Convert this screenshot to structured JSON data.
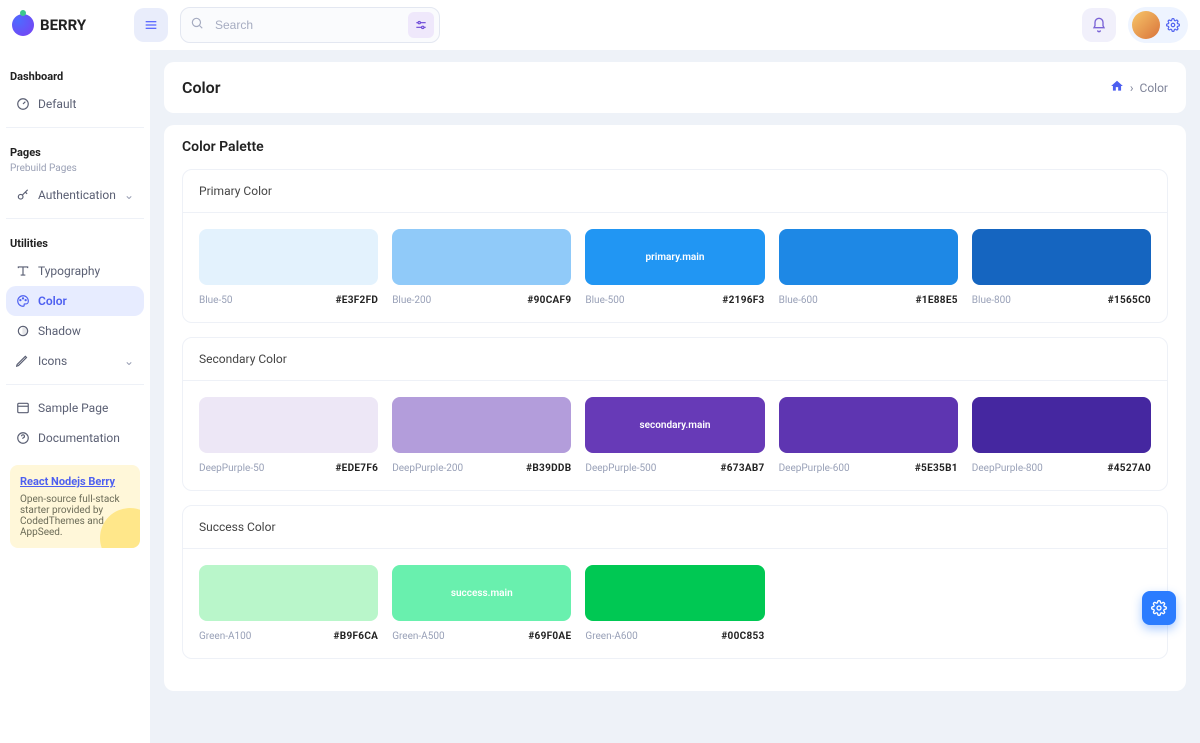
{
  "brand": "BERRY",
  "search": {
    "placeholder": "Search"
  },
  "sidebar": {
    "dashboard_label": "Dashboard",
    "default_label": "Default",
    "pages_label": "Pages",
    "pages_sub": "Prebuild Pages",
    "auth_label": "Authentication",
    "utilities_label": "Utilities",
    "typography_label": "Typography",
    "color_label": "Color",
    "shadow_label": "Shadow",
    "icons_label": "Icons",
    "sample_page_label": "Sample Page",
    "documentation_label": "Documentation",
    "promo_link": "React Nodejs Berry",
    "promo_text": "Open-source full-stack starter provided by CodedThemes and AppSeed."
  },
  "page": {
    "title": "Color",
    "breadcrumb_current": "Color"
  },
  "palette": {
    "title": "Color Palette",
    "groups": [
      {
        "title": "Primary Color",
        "swatches": [
          {
            "name": "Blue-50",
            "hex": "#E3F2FD",
            "bg": "#E3F2FD",
            "label": ""
          },
          {
            "name": "Blue-200",
            "hex": "#90CAF9",
            "bg": "#90CAF9",
            "label": ""
          },
          {
            "name": "Blue-500",
            "hex": "#2196F3",
            "bg": "#2196F3",
            "label": "primary.main"
          },
          {
            "name": "Blue-600",
            "hex": "#1E88E5",
            "bg": "#1E88E5",
            "label": ""
          },
          {
            "name": "Blue-800",
            "hex": "#1565C0",
            "bg": "#1565C0",
            "label": ""
          }
        ]
      },
      {
        "title": "Secondary Color",
        "swatches": [
          {
            "name": "DeepPurple-50",
            "hex": "#EDE7F6",
            "bg": "#EDE7F6",
            "label": ""
          },
          {
            "name": "DeepPurple-200",
            "hex": "#B39DDB",
            "bg": "#B39DDB",
            "label": ""
          },
          {
            "name": "DeepPurple-500",
            "hex": "#673AB7",
            "bg": "#673AB7",
            "label": "secondary.main"
          },
          {
            "name": "DeepPurple-600",
            "hex": "#5E35B1",
            "bg": "#5E35B1",
            "label": ""
          },
          {
            "name": "DeepPurple-800",
            "hex": "#4527A0",
            "bg": "#4527A0",
            "label": ""
          }
        ]
      },
      {
        "title": "Success Color",
        "swatches": [
          {
            "name": "Green-A100",
            "hex": "#B9F6CA",
            "bg": "#B9F6CA",
            "label": ""
          },
          {
            "name": "Green-A500",
            "hex": "#69F0AE",
            "bg": "#69F0AE",
            "label": "success.main"
          },
          {
            "name": "Green-A600",
            "hex": "#00C853",
            "bg": "#00C853",
            "label": ""
          }
        ]
      }
    ]
  }
}
